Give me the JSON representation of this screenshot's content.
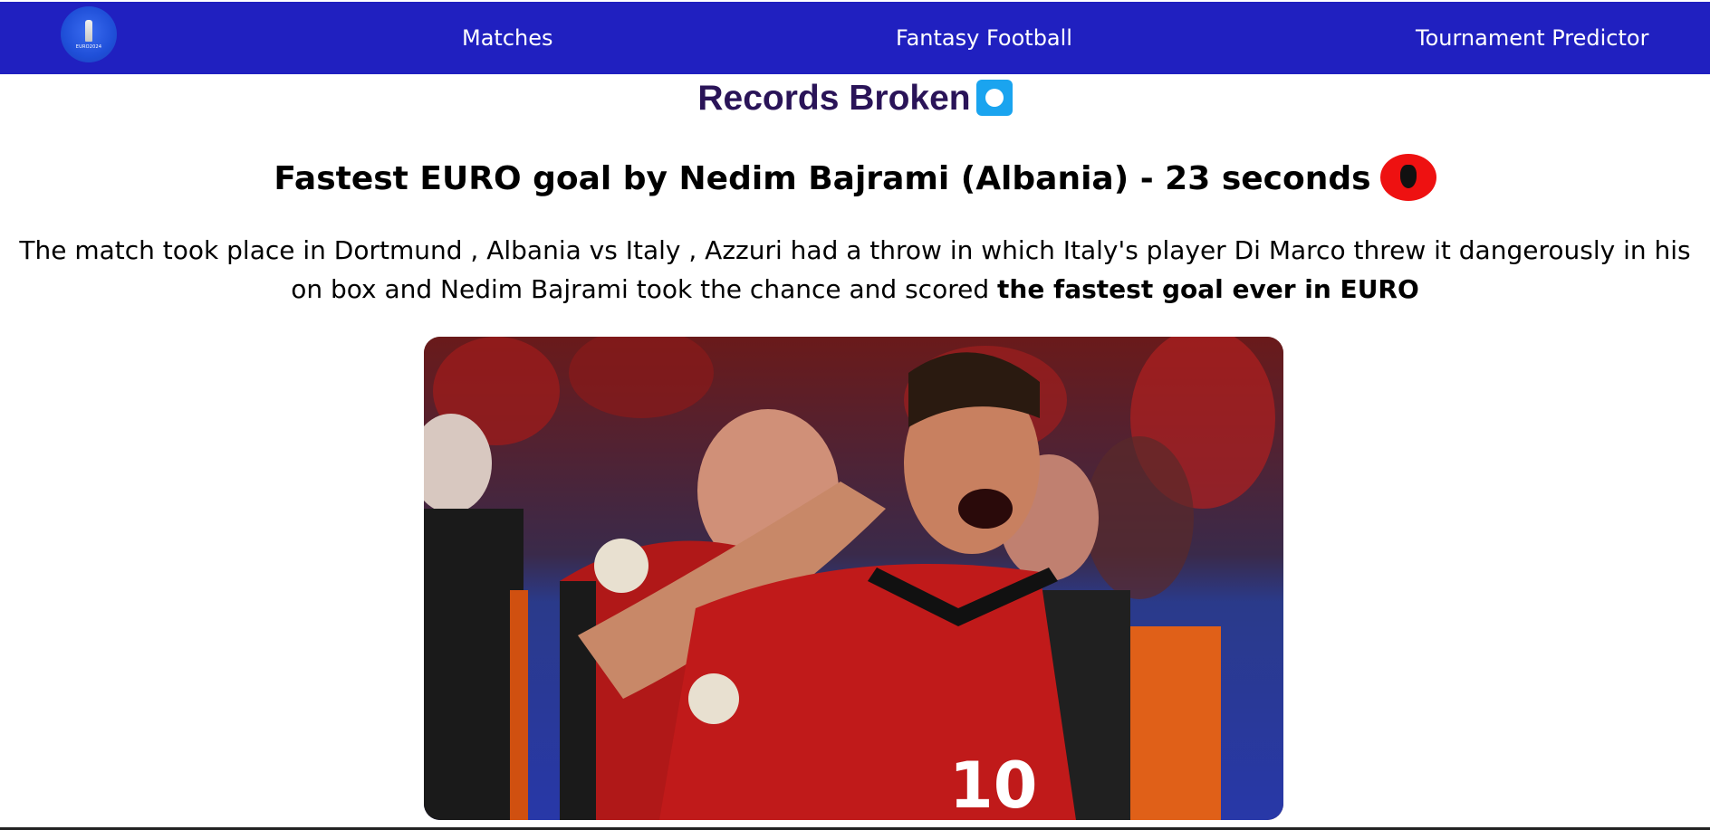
{
  "navbar": {
    "logo_icon": "euro-2024-trophy-logo",
    "logo_text": "EURO2024",
    "links": [
      "Matches",
      "Fantasy Football",
      "Tournament Predictor"
    ],
    "background": "#2020c0"
  },
  "records": {
    "title": "Records Broken",
    "title_icon": "blue-o-button-emoji",
    "items": [
      {
        "heading": "Fastest EURO goal by Nedim Bajrami (Albania) - 23 seconds",
        "flag_icon": "albania-flag-icon",
        "description": "The match took place in Dortmund , Albania vs Italy , Azzuri had a throw in which Italy's player Di Marco threw it dangerously in his on box and Nedim Bajrami took the chance and scored ",
        "description_bold": "the fastest goal ever in EURO",
        "image_alt": "nedim-bajrami-celebration-photo"
      }
    ]
  },
  "colors": {
    "title": "#2a1458",
    "flag_red": "#ee1111",
    "emoji_blue": "#1aa4ef"
  }
}
